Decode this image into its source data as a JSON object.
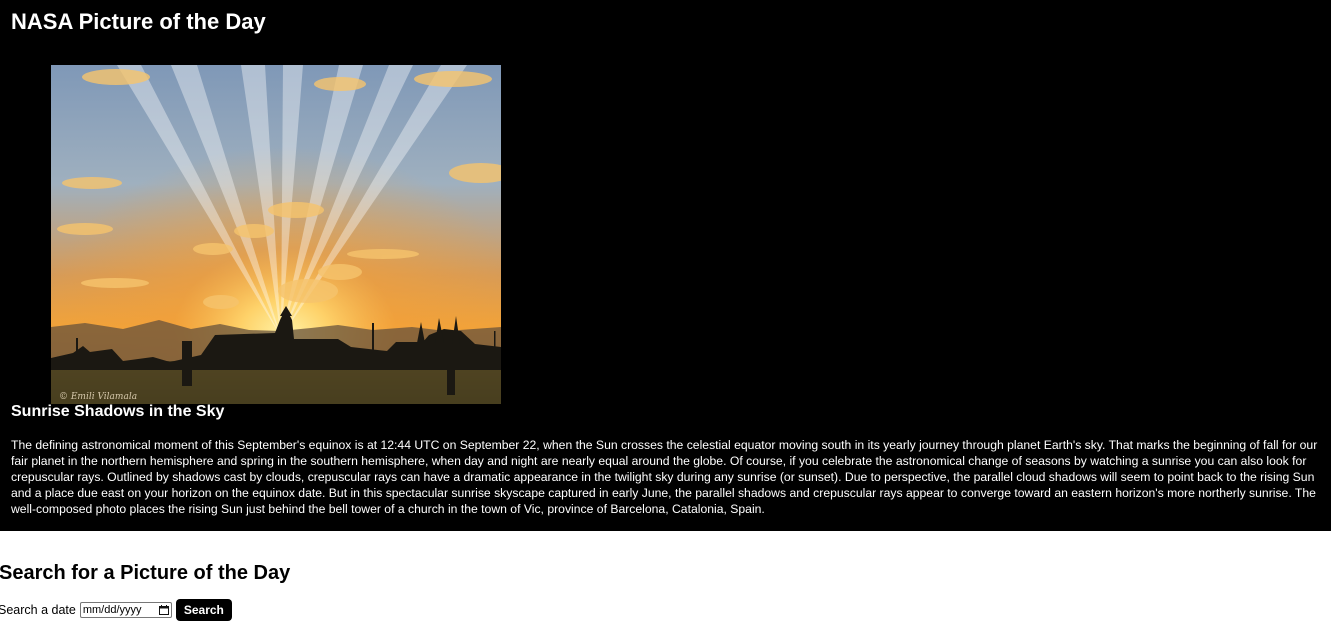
{
  "page": {
    "title": "NASA Picture of the Day"
  },
  "apod": {
    "image_alt": "Sunrise Shadows in the Sky",
    "image_credit": "© Emili Vilamala",
    "title": "Sunrise Shadows in the Sky",
    "explanation": "The defining astronomical moment of this September's equinox is at 12:44 UTC on September 22, when the Sun crosses the celestial equator moving south in its yearly journey through planet Earth's sky. That marks the beginning of fall for our fair planet in the northern hemisphere and spring in the southern hemisphere, when day and night are nearly equal around the globe. Of course, if you celebrate the astronomical change of seasons by watching a sunrise you can also look for crepuscular rays. Outlined by shadows cast by clouds, crepuscular rays can have a dramatic appearance in the twilight sky during any sunrise (or sunset). Due to perspective, the parallel cloud shadows will seem to point back to the rising Sun and a place due east on your horizon on the equinox date. But in this spectacular sunrise skyscape captured in early June, the parallel shadows and crepuscular rays appear to converge toward an eastern horizon's more northerly sunrise. The well-composed photo places the rising Sun just behind the bell tower of a church in the town of Vic, province of Barcelona, Catalonia, Spain."
  },
  "search": {
    "heading": "Search for a Picture of the Day",
    "label": "Search a date",
    "date_placeholder": "mm/dd/yyyy",
    "button_label": "Search"
  },
  "icons": {
    "calendar": "calendar-icon"
  },
  "colors": {
    "hero_background": "#000000",
    "page_background": "#ffffff",
    "button_background": "#000000",
    "button_text": "#ffffff",
    "sunrise_orange": "#f39a2a"
  }
}
